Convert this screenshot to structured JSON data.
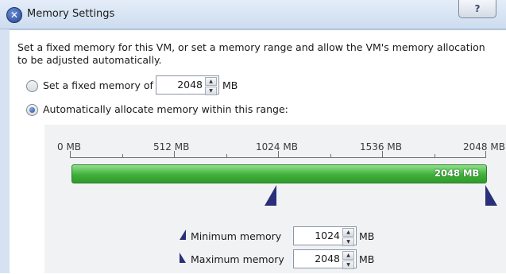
{
  "window": {
    "title": "Memory Settings",
    "help_label": "?"
  },
  "description": "Set a fixed memory for this VM, or set a memory range and allow the VM's memory allocation to be adjusted automatically.",
  "fixed": {
    "label": "Set a fixed memory of",
    "value": "2048",
    "unit": "MB",
    "selected": false
  },
  "auto": {
    "label": "Automatically allocate memory within this range:",
    "selected": true
  },
  "scale": {
    "ticks": [
      "0 MB",
      "512 MB",
      "1024 MB",
      "1536 MB",
      "2048 MB"
    ]
  },
  "range_bar": {
    "label": "2048 MB",
    "fill_fraction": 1.0,
    "min_fraction": 0.5,
    "max_fraction": 1.0,
    "color": "#3fb03a"
  },
  "minimum": {
    "label": "Minimum memory",
    "value": "1024",
    "unit": "MB"
  },
  "maximum": {
    "label": "Maximum memory",
    "value": "2048",
    "unit": "MB"
  },
  "colors": {
    "title_bar": "#cddcef",
    "slider": "#2a2f7a",
    "bar": "#3fb03a"
  },
  "icons": {
    "app": "vm-icon",
    "spin_up": "spin-up-arrow",
    "spin_down": "spin-down-arrow"
  }
}
